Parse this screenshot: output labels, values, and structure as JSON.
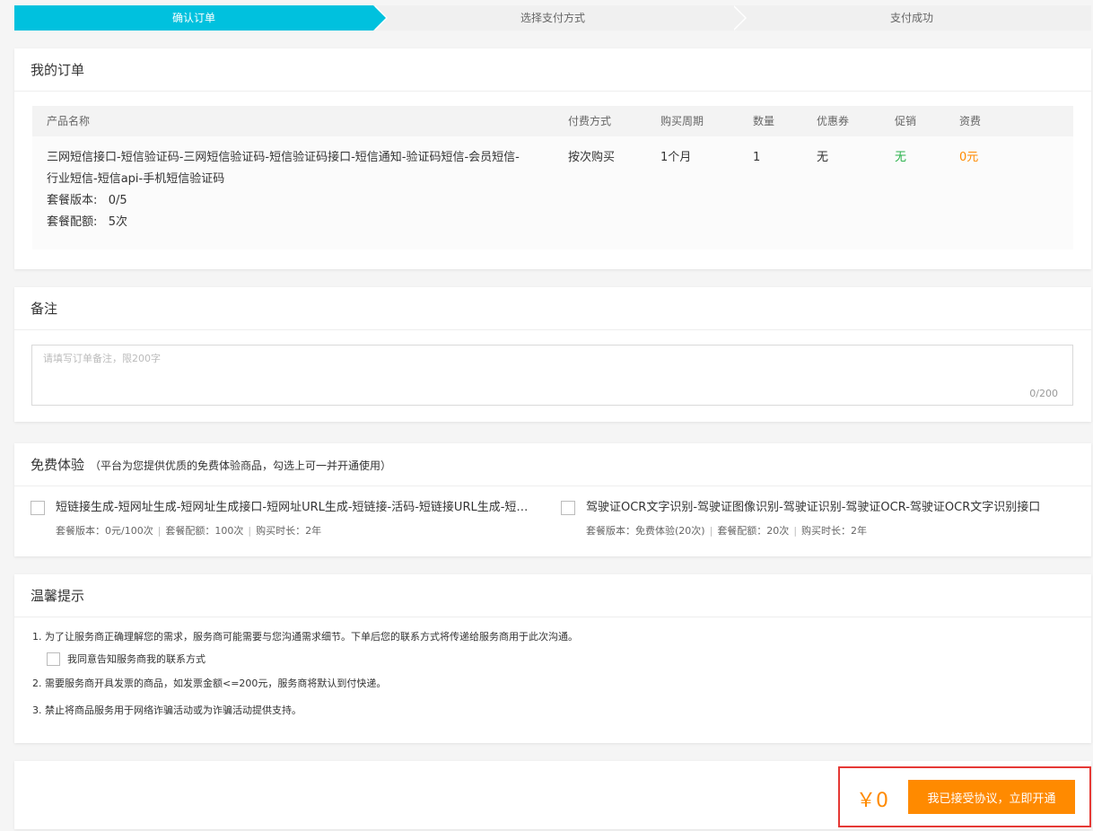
{
  "steps": [
    "确认订单",
    "选择支付方式",
    "支付成功"
  ],
  "order": {
    "title": "我的订单",
    "headers": [
      "产品名称",
      "付费方式",
      "购买周期",
      "数量",
      "优惠券",
      "促销",
      "资费"
    ],
    "product_line1": "三网短信接口-短信验证码-三网短信验证码-短信验证码接口-短信通知-验证码短信-会员短信-",
    "product_line2": "行业短信-短信api-手机短信验证码",
    "version": "套餐版本:   0/5",
    "quota": "套餐配额:   5次",
    "pay_type": "按次购买",
    "period": "1个月",
    "qty": "1",
    "coupon": "无",
    "promo": "无",
    "fee": "0元"
  },
  "remark": {
    "title": "备注",
    "placeholder": "请填写订单备注，限200字",
    "count": "0/200"
  },
  "trial": {
    "title": "免费体验",
    "subtitle": "（平台为您提供优质的免费体验商品，勾选上可一并开通使用）",
    "items": [
      {
        "name": "短链接生成-短网址生成-短网址生成接口-短网址URL生成-短链接-活码-短链接URL生成-短网址",
        "version": "套餐版本：0元/100次",
        "quota": "套餐配额：100次",
        "duration": "购买时长：2年"
      },
      {
        "name": "驾驶证OCR文字识别-驾驶证图像识别-驾驶证识别-驾驶证OCR-驾驶证OCR文字识别接口",
        "version": "套餐版本：免费体验(20次)",
        "quota": "套餐配额：20次",
        "duration": "购买时长：2年"
      }
    ]
  },
  "tips": {
    "title": "温馨提示",
    "tip1": "1. 为了让服务商正确理解您的需求，服务商可能需要与您沟通需求细节。下单后您的联系方式将传递给服务商用于此次沟通。",
    "agree_label": "我同意告知服务商我的联系方式",
    "tip2": "2. 需要服务商开具发票的商品，如发票金额<=200元，服务商将默认到付快递。",
    "tip3": "3. 禁止将商品服务用于网络诈骗活动或为诈骗活动提供支持。"
  },
  "footer": {
    "price": "￥0",
    "button": "我已接受协议，立即开通"
  },
  "colors": {
    "accent": "#00c1de",
    "orange": "#ff8a00",
    "green": "#2bb24c",
    "highlight": "#e53935"
  }
}
